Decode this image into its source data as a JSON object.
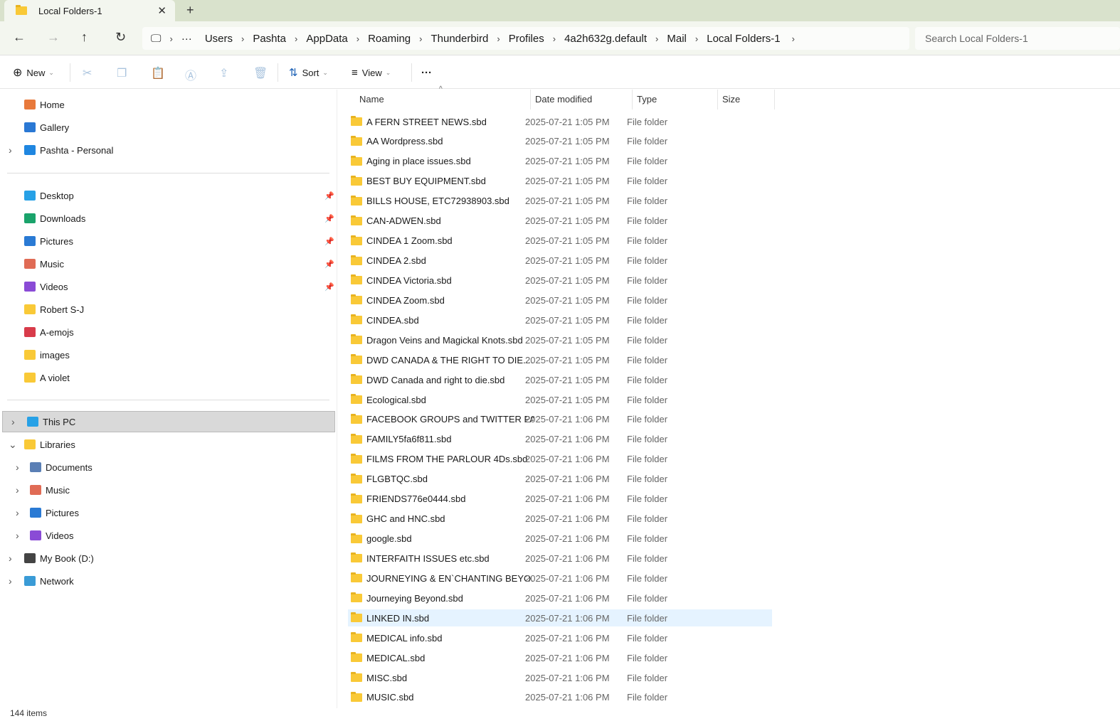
{
  "window": {
    "tab_title": "Local Folders-1",
    "new_tab": "+",
    "close": "✕"
  },
  "nav": {
    "breadcrumb": [
      "Users",
      "Pashta",
      "AppData",
      "Roaming",
      "Thunderbird",
      "Profiles",
      "4a2h632g.default",
      "Mail",
      "Local Folders-1"
    ],
    "ellipsis": "···",
    "search_placeholder": "Search Local Folders-1"
  },
  "toolbar": {
    "new": "New",
    "sort": "Sort",
    "view": "View",
    "more": "···"
  },
  "sidebar": {
    "top": [
      {
        "label": "Home",
        "color": "#e8793b"
      },
      {
        "label": "Gallery",
        "color": "#2a78d4"
      },
      {
        "label": "Pashta - Personal",
        "color": "#1f86e0"
      }
    ],
    "quick": [
      {
        "label": "Desktop",
        "color": "#27a1e6",
        "pinned": true
      },
      {
        "label": "Downloads",
        "color": "#1aa36b",
        "pinned": true
      },
      {
        "label": "Pictures",
        "color": "#2a7ad4",
        "pinned": true
      },
      {
        "label": "Music",
        "color": "#e06b55",
        "pinned": true
      },
      {
        "label": "Videos",
        "color": "#8a4bd6",
        "pinned": true
      },
      {
        "label": "Robert S-J",
        "color": "#f9c937"
      },
      {
        "label": "A-emojs",
        "color": "#d83b4a"
      },
      {
        "label": "images",
        "color": "#f9c937"
      },
      {
        "label": "A violet",
        "color": "#f9c937"
      }
    ],
    "tree": [
      {
        "label": "This PC",
        "color": "#27a1e6",
        "level": 0
      },
      {
        "label": "Libraries",
        "color": "#f9c937",
        "level": 0
      },
      {
        "label": "Documents",
        "color": "#5a7fb5",
        "level": 1
      },
      {
        "label": "Music",
        "color": "#e06b55",
        "level": 1
      },
      {
        "label": "Pictures",
        "color": "#2a7ad4",
        "level": 1
      },
      {
        "label": "Videos",
        "color": "#8a4bd6",
        "level": 1
      },
      {
        "label": "My Book (D:)",
        "color": "#444444",
        "level": 0
      },
      {
        "label": "Network",
        "color": "#3a9bd6",
        "level": 0
      }
    ]
  },
  "columns": {
    "name": "Name",
    "date": "Date modified",
    "type": "Type",
    "size": "Size"
  },
  "files": [
    {
      "name": "A FERN STREET NEWS.sbd",
      "date": "2025-07-21 1:05 PM",
      "type": "File folder"
    },
    {
      "name": "AA Wordpress.sbd",
      "date": "2025-07-21 1:05 PM",
      "type": "File folder"
    },
    {
      "name": "Aging in place issues.sbd",
      "date": "2025-07-21 1:05 PM",
      "type": "File folder"
    },
    {
      "name": "BEST BUY EQUIPMENT.sbd",
      "date": "2025-07-21 1:05 PM",
      "type": "File folder"
    },
    {
      "name": "BILLS HOUSE, ETC72938903.sbd",
      "date": "2025-07-21 1:05 PM",
      "type": "File folder"
    },
    {
      "name": "CAN-ADWEN.sbd",
      "date": "2025-07-21 1:05 PM",
      "type": "File folder"
    },
    {
      "name": "CINDEA 1 Zoom.sbd",
      "date": "2025-07-21 1:05 PM",
      "type": "File folder"
    },
    {
      "name": "CINDEA 2.sbd",
      "date": "2025-07-21 1:05 PM",
      "type": "File folder"
    },
    {
      "name": "CINDEA Victoria.sbd",
      "date": "2025-07-21 1:05 PM",
      "type": "File folder"
    },
    {
      "name": "CINDEA Zoom.sbd",
      "date": "2025-07-21 1:05 PM",
      "type": "File folder"
    },
    {
      "name": "CINDEA.sbd",
      "date": "2025-07-21 1:05 PM",
      "type": "File folder"
    },
    {
      "name": "Dragon Veins and Magickal Knots.sbd",
      "date": "2025-07-21 1:05 PM",
      "type": "File folder"
    },
    {
      "name": "DWD CANADA & THE RIGHT TO DIE....",
      "date": "2025-07-21 1:05 PM",
      "type": "File folder"
    },
    {
      "name": "DWD Canada and right to die.sbd",
      "date": "2025-07-21 1:05 PM",
      "type": "File folder"
    },
    {
      "name": "Ecological.sbd",
      "date": "2025-07-21 1:05 PM",
      "type": "File folder"
    },
    {
      "name": "FACEBOOK GROUPS and TWITTER PA...",
      "date": "2025-07-21 1:06 PM",
      "type": "File folder"
    },
    {
      "name": "FAMILY5fa6f811.sbd",
      "date": "2025-07-21 1:06 PM",
      "type": "File folder"
    },
    {
      "name": "FILMS FROM THE PARLOUR 4Ds.sbd",
      "date": "2025-07-21 1:06 PM",
      "type": "File folder"
    },
    {
      "name": "FLGBTQC.sbd",
      "date": "2025-07-21 1:06 PM",
      "type": "File folder"
    },
    {
      "name": "FRIENDS776e0444.sbd",
      "date": "2025-07-21 1:06 PM",
      "type": "File folder"
    },
    {
      "name": "GHC and HNC.sbd",
      "date": "2025-07-21 1:06 PM",
      "type": "File folder"
    },
    {
      "name": "google.sbd",
      "date": "2025-07-21 1:06 PM",
      "type": "File folder"
    },
    {
      "name": "INTERFAITH ISSUES etc.sbd",
      "date": "2025-07-21 1:06 PM",
      "type": "File folder"
    },
    {
      "name": "JOURNEYING & EN`CHANTING BEYO...",
      "date": "2025-07-21 1:06 PM",
      "type": "File folder"
    },
    {
      "name": "Journeying Beyond.sbd",
      "date": "2025-07-21 1:06 PM",
      "type": "File folder"
    },
    {
      "name": "LINKED IN.sbd",
      "date": "2025-07-21 1:06 PM",
      "type": "File folder",
      "highlighted": true
    },
    {
      "name": "MEDICAL info.sbd",
      "date": "2025-07-21 1:06 PM",
      "type": "File folder"
    },
    {
      "name": "MEDICAL.sbd",
      "date": "2025-07-21 1:06 PM",
      "type": "File folder"
    },
    {
      "name": "MISC.sbd",
      "date": "2025-07-21 1:06 PM",
      "type": "File folder"
    },
    {
      "name": "MUSIC.sbd",
      "date": "2025-07-21 1:06 PM",
      "type": "File folder"
    }
  ],
  "status": {
    "items": "144 items"
  }
}
